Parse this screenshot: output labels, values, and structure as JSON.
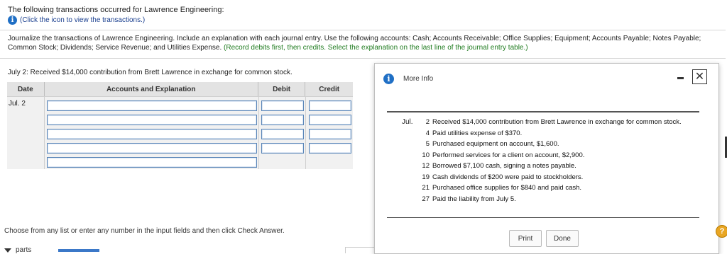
{
  "intro": {
    "line1": "The following transactions occurred for Lawrence Engineering:",
    "info_link": "(Click the icon to view the transactions.)"
  },
  "instructions": {
    "main": "Journalize the transactions of Lawrence Engineering. Include an explanation with each journal entry. Use the following accounts: Cash; Accounts Receivable; Office Supplies; Equipment; Accounts Payable; Notes Payable; Common Stock; Dividends; Service Revenue; and Utilities Expense.",
    "hint": "(Record debits first, then credits. Select the explanation on the last line of the journal entry table.)"
  },
  "prompt": "July 2: Received $14,000 contribution from Brett Lawrence in exchange for common stock.",
  "journal": {
    "headers": {
      "date": "Date",
      "accounts": "Accounts and Explanation",
      "debit": "Debit",
      "credit": "Credit"
    },
    "date_value": "Jul. 2",
    "rows": 5
  },
  "footer": {
    "choose": "Choose from any list or enter any number in the input fields and then click Check Answer.",
    "parts": "parts"
  },
  "modal": {
    "title": "More Info",
    "month": "Jul.",
    "transactions": [
      {
        "day": "2",
        "text": "Received $14,000 contribution from Brett Lawrence in exchange for common stock."
      },
      {
        "day": "4",
        "text": "Paid utilities expense of $370."
      },
      {
        "day": "5",
        "text": "Purchased equipment on account, $1,600."
      },
      {
        "day": "10",
        "text": "Performed services for a client on account, $2,900."
      },
      {
        "day": "12",
        "text": "Borrowed $7,100 cash, signing a notes payable."
      },
      {
        "day": "19",
        "text": "Cash dividends of $200 were paid to stockholders."
      },
      {
        "day": "21",
        "text": "Purchased office supplies for $840 and paid cash."
      },
      {
        "day": "27",
        "text": "Paid the liability from July 5."
      }
    ],
    "print_label": "Print",
    "done_label": "Done"
  },
  "icons": {
    "info": "info-icon",
    "help": "help-icon",
    "close": "close-icon",
    "minimize": "minimize-icon"
  },
  "colors": {
    "accent_blue": "#1f6fc5",
    "hint_green": "#1d7a1d",
    "help_orange": "#e9a623"
  }
}
